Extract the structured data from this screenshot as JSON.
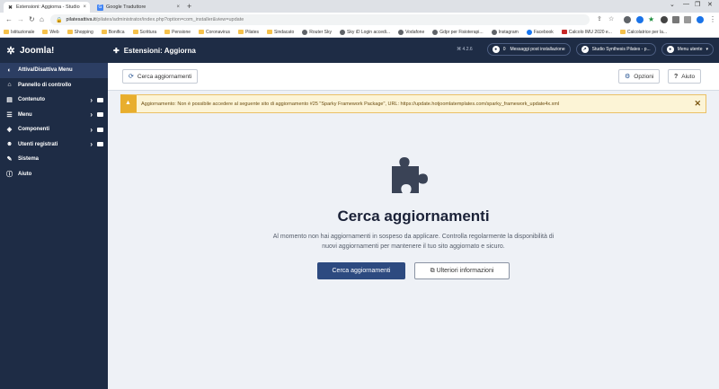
{
  "browser": {
    "tabs": [
      {
        "label": "Estensioni: Aggiorna - Studio Sy...",
        "active": true
      },
      {
        "label": "Google Traduttore",
        "active": false
      }
    ],
    "new_tab": "+",
    "url_domain": "pilatesattiva.it",
    "url_path": "/pilates/administrator/index.php?option=com_installer&view=update",
    "bookmarks": [
      {
        "label": "Istituzionale",
        "icon": "folder"
      },
      {
        "label": "Web",
        "icon": "folder"
      },
      {
        "label": "Shopping",
        "icon": "folder"
      },
      {
        "label": "Bonifica",
        "icon": "folder"
      },
      {
        "label": "Scrittura",
        "icon": "folder"
      },
      {
        "label": "Pensione",
        "icon": "folder"
      },
      {
        "label": "Coronavirus",
        "icon": "folder"
      },
      {
        "label": "Pilates",
        "icon": "folder"
      },
      {
        "label": "Sindacato",
        "icon": "folder"
      },
      {
        "label": "Router Sky",
        "icon": "globe"
      },
      {
        "label": "Sky iD Login accedi...",
        "icon": "globe"
      },
      {
        "label": "Vodafone",
        "icon": "globe"
      },
      {
        "label": "Gdpr per Fisioterapi...",
        "icon": "globe"
      },
      {
        "label": "Instagram",
        "icon": "globe"
      },
      {
        "label": "Facebook",
        "icon": "fb"
      },
      {
        "label": "Calcolo IMU 2020 e...",
        "icon": "red"
      },
      {
        "label": "Calcolatrice per la...",
        "icon": "folder"
      }
    ]
  },
  "header": {
    "logo_text": "Joomla!",
    "page_title": "Estensioni: Aggiorna",
    "version": "⌘ 4.2.6",
    "notifications_count": "0",
    "notifications_label": "Messaggi post installazione",
    "site_label": "Studio Synthesis Pilates - p...",
    "user_menu_label": "Menu utente"
  },
  "sidebar": {
    "items": [
      {
        "label": "Attiva/Disattiva Menu",
        "icon": "toggle-icon",
        "chevron": false
      },
      {
        "label": "Pannello di controllo",
        "icon": "home-icon",
        "chevron": false
      },
      {
        "label": "Contenuto",
        "icon": "file-icon",
        "chevron": true
      },
      {
        "label": "Menu",
        "icon": "list-icon",
        "chevron": true
      },
      {
        "label": "Componenti",
        "icon": "cubes-icon",
        "chevron": true
      },
      {
        "label": "Utenti registrati",
        "icon": "users-icon",
        "chevron": true
      },
      {
        "label": "Sistema",
        "icon": "wrench-icon",
        "chevron": false
      },
      {
        "label": "Aiuto",
        "icon": "info-icon",
        "chevron": false
      }
    ]
  },
  "toolbar": {
    "find_updates_label": "Cerca aggiornamenti",
    "options_label": "Opzioni",
    "help_label": "Aiuto"
  },
  "alert": {
    "message": "Aggiornamento: Non è possibile accedere al seguente sito di aggiornamento #25 \"Sparky Framework Package\", URL: https://update.hotjoomlatemplates.com/sparky_framework_update4x.xml"
  },
  "main": {
    "title": "Cerca aggiornamenti",
    "description": "Al momento non hai aggiornamenti in sospeso da applicare. Controlla regolarmente la disponibilità di nuovi aggiornamenti per mantenere il tuo sito aggiornato e sicuro.",
    "primary_button": "Cerca aggiornamenti",
    "secondary_button": "Ulteriori informazioni"
  },
  "colors": {
    "sidebar_bg": "#1e2c45",
    "primary": "#2d4a80",
    "warning": "#e8ae2d",
    "page_bg": "#eef1f6"
  }
}
